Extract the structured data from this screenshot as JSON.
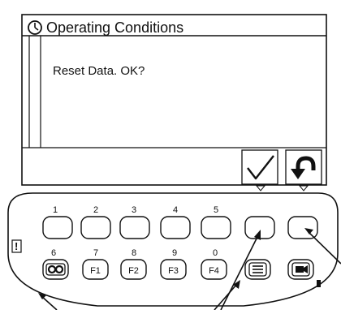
{
  "screen": {
    "title": "Operating Conditions",
    "message": "Reset Data. OK?",
    "title_icon": "clock-icon",
    "softkeys": [
      {
        "icon": "checkmark-icon"
      },
      {
        "icon": "return-arrow-icon"
      }
    ]
  },
  "keypad": {
    "warning_label": "!",
    "top_row_labels": [
      "1",
      "2",
      "3",
      "4",
      "5"
    ],
    "bottom_row_numbers": [
      "6",
      "7",
      "8",
      "9",
      "0"
    ],
    "bottom_row_keys": [
      {
        "label": "",
        "icon": "infinity-icon"
      },
      {
        "label": "F1"
      },
      {
        "label": "F2"
      },
      {
        "label": "F3"
      },
      {
        "label": "F4"
      },
      {
        "label": "",
        "icon": "menu-list-icon"
      },
      {
        "label": "",
        "icon": "camera-key-icon"
      }
    ]
  },
  "colors": {
    "outline": "#111111",
    "background": "#ffffff"
  }
}
